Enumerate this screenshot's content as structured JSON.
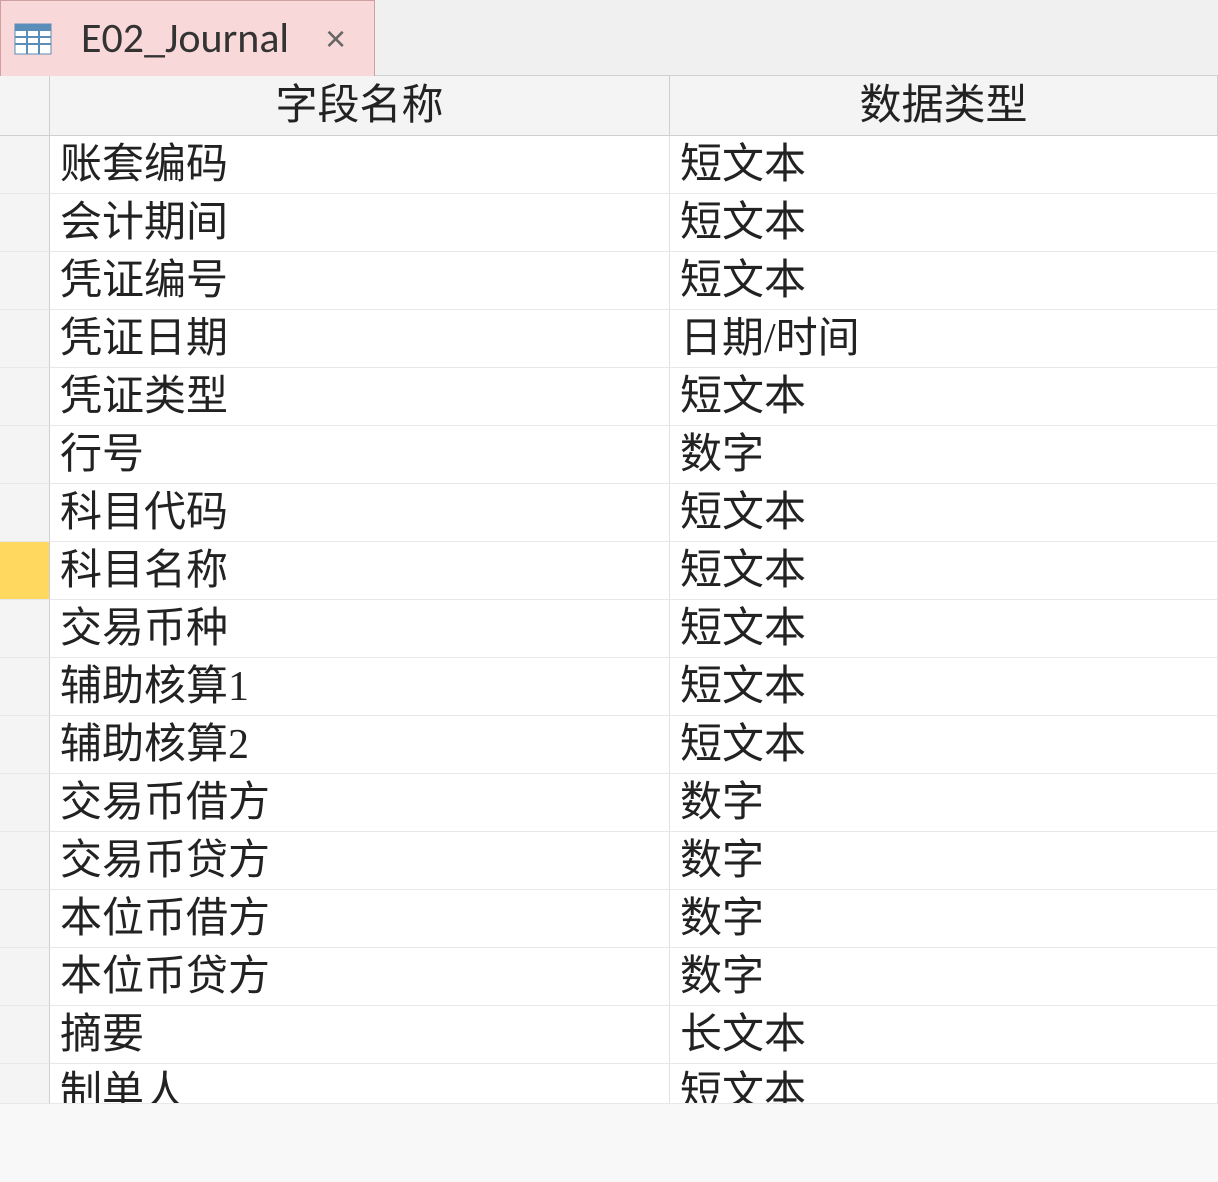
{
  "tab": {
    "label": "E02_Journal",
    "close_glyph": "×"
  },
  "columns": {
    "field_name": "字段名称",
    "data_type": "数据类型"
  },
  "rows": [
    {
      "field": "账套编码",
      "type": "短文本",
      "active": false
    },
    {
      "field": "会计期间",
      "type": "短文本",
      "active": false
    },
    {
      "field": "凭证编号",
      "type": "短文本",
      "active": false
    },
    {
      "field": "凭证日期",
      "type": "日期/时间",
      "active": false
    },
    {
      "field": "凭证类型",
      "type": "短文本",
      "active": false
    },
    {
      "field": "行号",
      "type": "数字",
      "active": false
    },
    {
      "field": "科目代码",
      "type": "短文本",
      "active": false
    },
    {
      "field": "科目名称",
      "type": "短文本",
      "active": true
    },
    {
      "field": "交易币种",
      "type": "短文本",
      "active": false
    },
    {
      "field": "辅助核算1",
      "type": "短文本",
      "active": false
    },
    {
      "field": "辅助核算2",
      "type": "短文本",
      "active": false
    },
    {
      "field": "交易币借方",
      "type": "数字",
      "active": false
    },
    {
      "field": "交易币贷方",
      "type": "数字",
      "active": false
    },
    {
      "field": "本位币借方",
      "type": "数字",
      "active": false
    },
    {
      "field": "本位币贷方",
      "type": "数字",
      "active": false
    },
    {
      "field": "摘要",
      "type": "长文本",
      "active": false
    },
    {
      "field": "制单人",
      "type": "短文本",
      "active": false
    }
  ]
}
